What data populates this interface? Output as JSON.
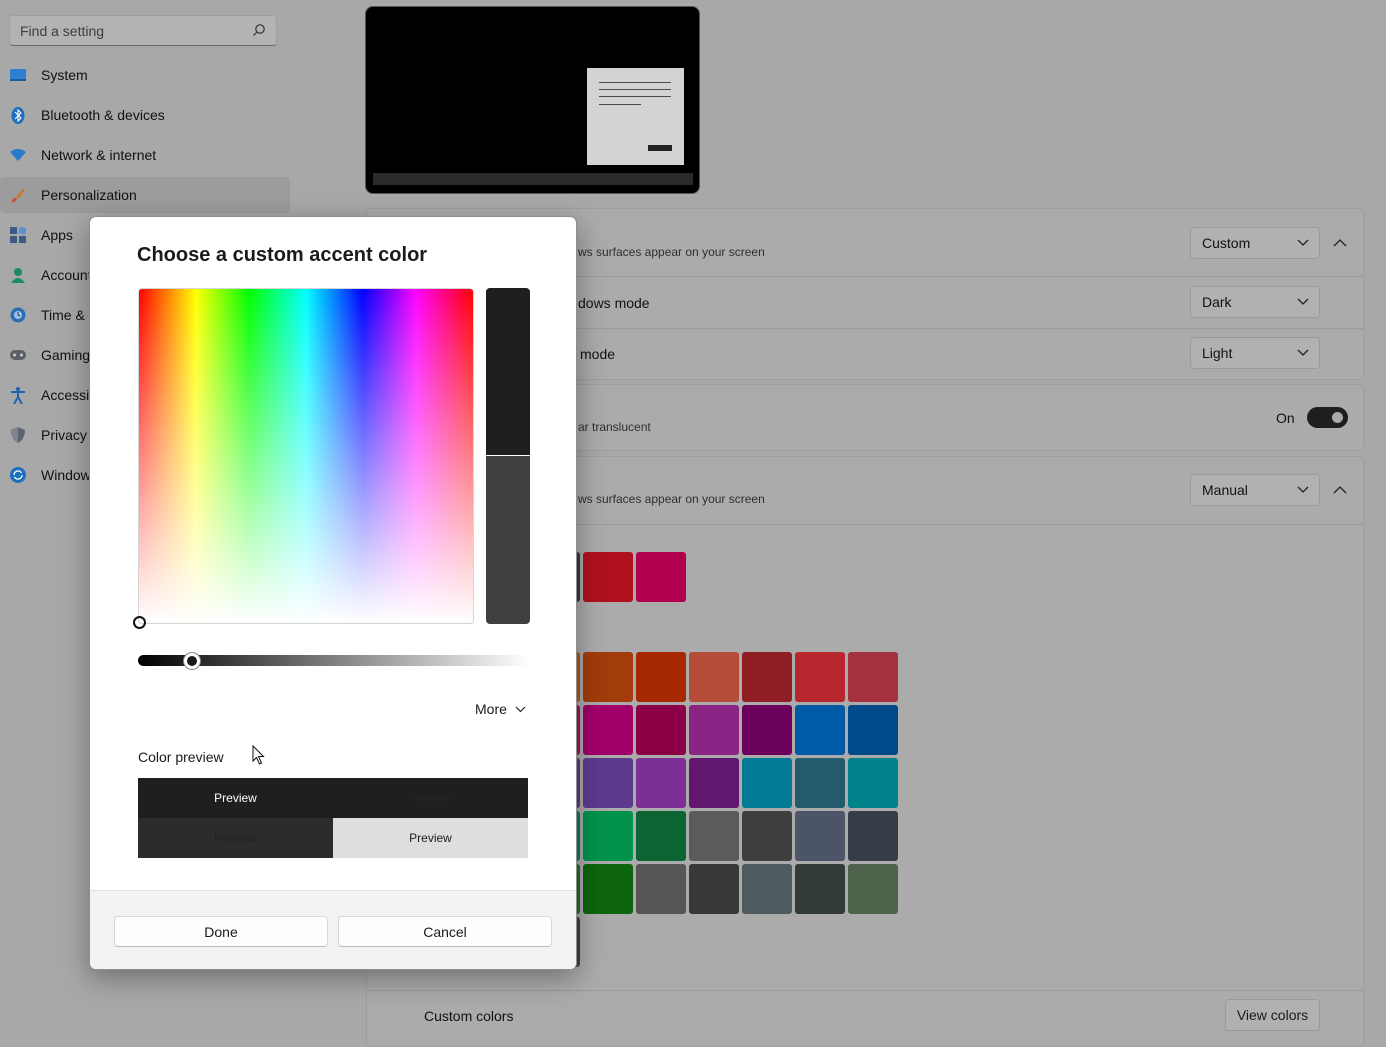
{
  "search": {
    "placeholder": "Find a setting"
  },
  "sidebar": {
    "items": [
      {
        "label": "System",
        "icon": "system-icon"
      },
      {
        "label": "Bluetooth & devices",
        "icon": "bluetooth-icon"
      },
      {
        "label": "Network & internet",
        "icon": "wifi-icon"
      },
      {
        "label": "Personalization",
        "icon": "brush-icon",
        "active": true
      },
      {
        "label": "Apps",
        "icon": "apps-icon"
      },
      {
        "label": "Accounts",
        "icon": "account-icon"
      },
      {
        "label": "Time & language",
        "icon": "clock-icon"
      },
      {
        "label": "Gaming",
        "icon": "gamepad-icon"
      },
      {
        "label": "Accessibility",
        "icon": "accessibility-icon"
      },
      {
        "label": "Privacy & security",
        "icon": "shield-icon"
      },
      {
        "label": "Windows Update",
        "icon": "update-icon"
      }
    ]
  },
  "content": {
    "mode_desc": "ws surfaces appear on your screen",
    "mode_value": "Custom",
    "windows_mode_label": "dows mode",
    "windows_mode_value": "Dark",
    "app_mode_label": "mode",
    "app_mode_value": "Light",
    "transparency_desc": "ar translucent",
    "transparency_state": "On",
    "accent_desc": "ws surfaces appear on your screen",
    "accent_value": "Manual",
    "recent_colors": [
      "#b0111f",
      "#b3004e"
    ],
    "windows_colors": [
      [
        "#a23c0b",
        "#a62800",
        "#b54c38",
        "#8f1f24",
        "#b7282e",
        "#a3323e"
      ],
      [
        "#a20069",
        "#8c0047",
        "#8a2484",
        "#6b005d",
        "#005aa6",
        "#004a89"
      ],
      [
        "#5d3a8e",
        "#7c2f96",
        "#61176f",
        "#007a95",
        "#235b6d",
        "#00828a"
      ],
      [
        "#00934b",
        "#0a6532",
        "#5b5b5b",
        "#3e3e3e",
        "#4b5567",
        "#353d47"
      ],
      [
        "#0d660d",
        "#565656",
        "#383838",
        "#4e5a5d",
        "#323a3a",
        "#4e614b"
      ]
    ],
    "custom_colors_label": "Custom colors",
    "view_colors_label": "View colors"
  },
  "dialog": {
    "title": "Choose a custom accent color",
    "more_label": "More",
    "color_preview_label": "Color preview",
    "preview_text": "Preview",
    "new_color": "#1f1f1f",
    "old_color": "#404040",
    "value_slider_level": 0.14,
    "done_label": "Done",
    "cancel_label": "Cancel"
  }
}
